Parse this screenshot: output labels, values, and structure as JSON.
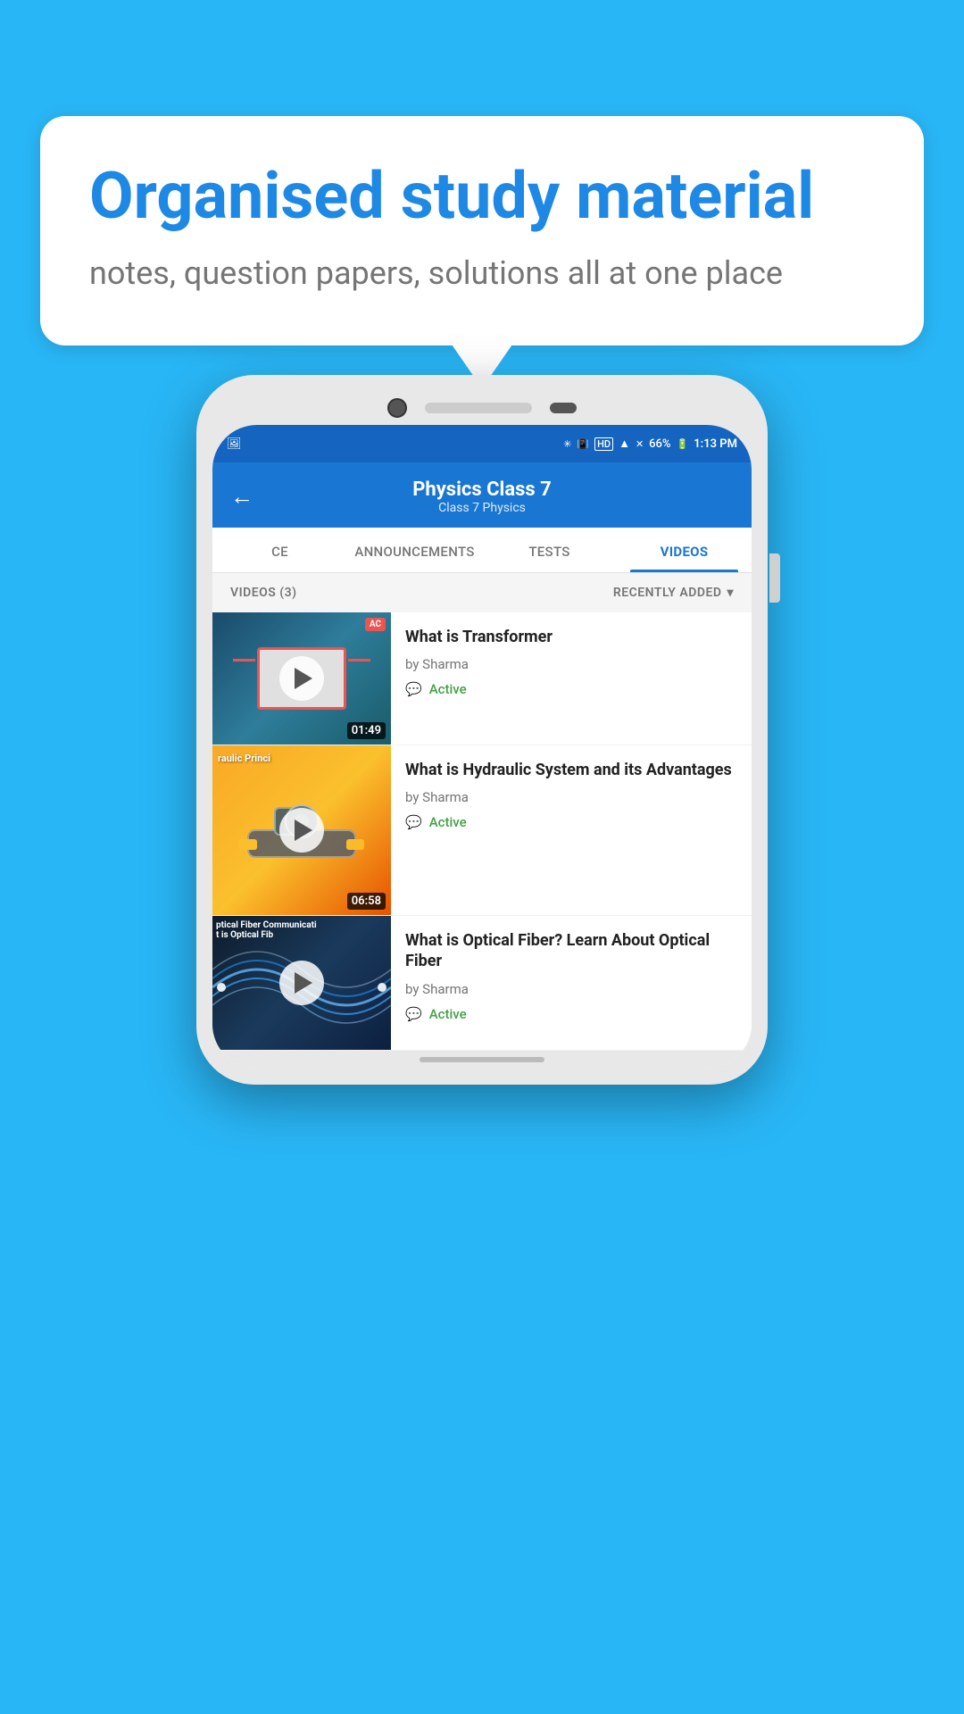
{
  "background_color": "#29b6f6",
  "speech_bubble": {
    "heading": "Organised study material",
    "subtext": "notes, question papers, solutions all at one place"
  },
  "phone": {
    "status_bar": {
      "time": "1:13 PM",
      "battery": "66%",
      "signal": "HD"
    },
    "app_bar": {
      "title": "Physics Class 7",
      "subtitle": "Class 7   Physics",
      "back_label": "←"
    },
    "tabs": [
      {
        "label": "CE",
        "active": false
      },
      {
        "label": "ANNOUNCEMENTS",
        "active": false
      },
      {
        "label": "TESTS",
        "active": false
      },
      {
        "label": "VIDEOS",
        "active": true
      }
    ],
    "videos_header": {
      "count": "VIDEOS (3)",
      "sort": "RECENTLY ADDED"
    },
    "videos": [
      {
        "title": "What is  Transformer",
        "author": "by Sharma",
        "status": "Active",
        "duration": "01:49",
        "thumb_type": "transformer"
      },
      {
        "title": "What is Hydraulic System and its Advantages",
        "author": "by Sharma",
        "status": "Active",
        "duration": "06:58",
        "thumb_type": "hydraulic"
      },
      {
        "title": "What is Optical Fiber? Learn About Optical Fiber",
        "author": "by Sharma",
        "status": "Active",
        "duration": "",
        "thumb_type": "optical"
      }
    ]
  }
}
